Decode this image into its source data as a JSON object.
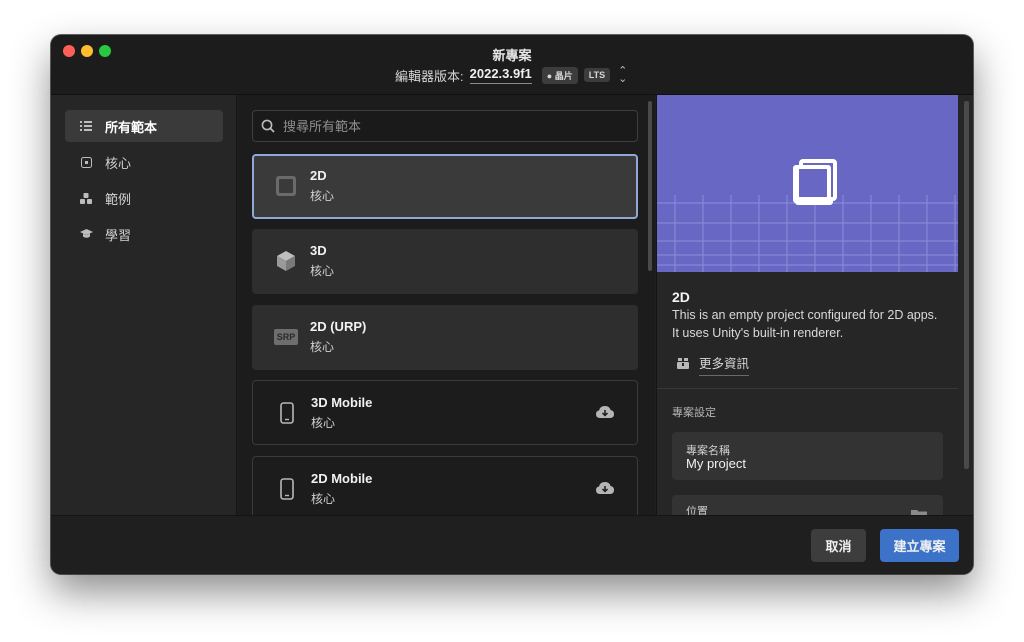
{
  "window": {
    "title": "新專案",
    "editor_label": "編輯器版本:",
    "editor_version": "2022.3.9f1",
    "chip_badge": "晶片",
    "lts_badge": "LTS"
  },
  "sidebar": {
    "items": [
      {
        "label": "所有範本",
        "icon": "list-icon",
        "active": true
      },
      {
        "label": "核心",
        "icon": "core-icon",
        "active": false
      },
      {
        "label": "範例",
        "icon": "samples-icon",
        "active": false
      },
      {
        "label": "學習",
        "icon": "learn-icon",
        "active": false
      }
    ]
  },
  "search": {
    "placeholder": "搜尋所有範本"
  },
  "templates": [
    {
      "title": "2D",
      "subtitle": "核心",
      "icon": "2d-square-icon",
      "selected": true,
      "download": false
    },
    {
      "title": "3D",
      "subtitle": "核心",
      "icon": "3d-cube-icon",
      "selected": false,
      "download": false
    },
    {
      "title": "2D (URP)",
      "subtitle": "核心",
      "icon": "srp-icon",
      "icon_text": "SRP",
      "selected": false,
      "download": false
    },
    {
      "title": "3D Mobile",
      "subtitle": "核心",
      "icon": "mobile-icon",
      "selected": false,
      "download": true
    },
    {
      "title": "2D Mobile",
      "subtitle": "核心",
      "icon": "mobile-icon",
      "selected": false,
      "download": true
    }
  ],
  "detail": {
    "title": "2D",
    "description": "This is an empty project configured for 2D apps. It uses Unity's built-in renderer.",
    "more_info": "更多資訊",
    "settings_heading": "專案設定",
    "project_name_label": "專案名稱",
    "project_name_value": "My project",
    "location_label": "位置"
  },
  "footer": {
    "cancel": "取消",
    "create": "建立專案"
  },
  "colors": {
    "accent": "#3c72c8",
    "preview_bg": "#6868c4",
    "selected_border": "#8fa8d8"
  }
}
